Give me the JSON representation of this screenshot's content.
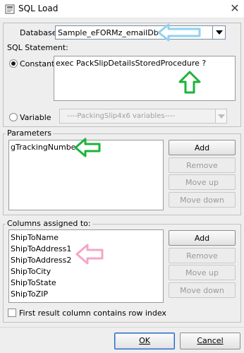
{
  "window": {
    "title": "SQL Load",
    "close_glyph": "✕",
    "icon": "database-load-icon"
  },
  "database": {
    "label": "Database",
    "value": "Sample_eFORMz_emailDb"
  },
  "sql_statement": {
    "legend": "SQL Statement:",
    "constant_label": "Constant",
    "constant_value": "exec PackSlipDetailsStoredProcedure ?",
    "variable_label": "Variable",
    "variable_placeholder": "----PackingSlip4x6 variables----",
    "selected": "Constant"
  },
  "parameters": {
    "legend": "Parameters",
    "items": [
      "gTrackingNumber"
    ],
    "buttons": {
      "add": "Add",
      "remove": "Remove",
      "move_up": "Move up",
      "move_down": "Move down"
    }
  },
  "columns": {
    "legend": "Columns assigned to:",
    "items": [
      "ShipToName",
      "ShipToAddress1",
      "ShipToAddress2",
      "ShipToCity",
      "ShipToState",
      "ShipToZIP"
    ],
    "buttons": {
      "add": "Add",
      "remove": "Remove",
      "move_up": "Move up",
      "move_down": "Move down"
    }
  },
  "row_index": {
    "label": "First result column contains row index",
    "checked": false
  },
  "footer": {
    "ok": "OK",
    "cancel": "Cancel"
  },
  "annotation_colors": {
    "blue": "#8fd3ee",
    "green": "#1db33b",
    "pink": "#f4a6c7"
  }
}
